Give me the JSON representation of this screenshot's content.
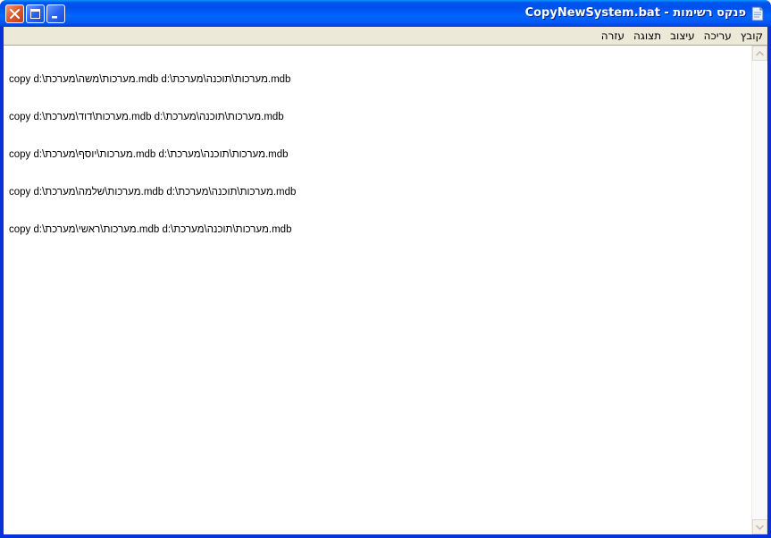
{
  "window": {
    "title": "CopyNewSystem.bat - פנקס רשימות"
  },
  "menu": {
    "items": [
      "קובץ",
      "עריכה",
      "עיצוב",
      "תצוגה",
      "עזרה"
    ]
  },
  "editor": {
    "lines": [
      "copy d:\\מערכות\\משה\\מערכת.mdb d:\\מערכות\\תוכנה\\מערכת.mdb",
      "copy d:\\מערכות\\דוד\\מערכת.mdb d:\\מערכות\\תוכנה\\מערכת.mdb",
      "copy d:\\מערכות\\יוסף\\מערכת.mdb d:\\מערכות\\תוכנה\\מערכת.mdb",
      "copy d:\\מערכות\\שלמה\\מערכת.mdb d:\\מערכות\\תוכנה\\מערכת.mdb",
      "copy d:\\מערכות\\ראשי\\מערכת.mdb d:\\מערכות\\תוכנה\\מערכת.mdb"
    ]
  },
  "icons": {
    "title_icon": "notepad-icon",
    "close": "close-icon",
    "maximize": "maximize-icon",
    "minimize": "minimize-icon",
    "scroll_up": "arrow-up-icon",
    "scroll_down": "arrow-down-icon"
  },
  "colors": {
    "titlebar": "#0058ee",
    "close_button": "#e35a2e",
    "menubar": "#ece9d8"
  }
}
